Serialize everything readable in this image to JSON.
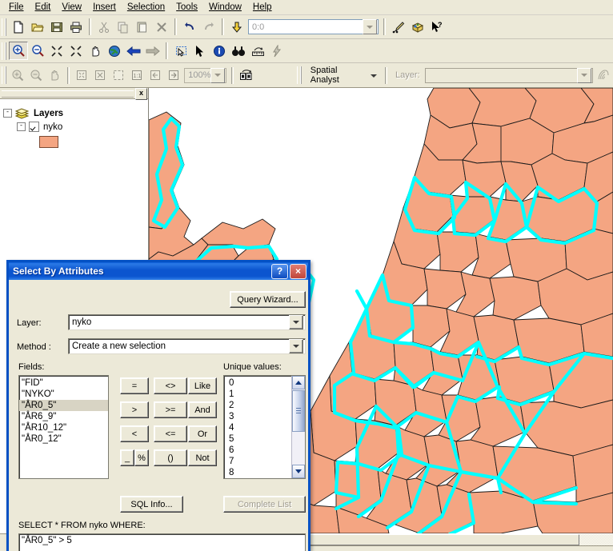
{
  "menu": {
    "items": [
      "File",
      "Edit",
      "View",
      "Insert",
      "Selection",
      "Tools",
      "Window",
      "Help"
    ]
  },
  "toolbars": {
    "standard": {
      "buttons": [
        "new-icon",
        "open-icon",
        "save-icon",
        "print-icon",
        "cut-icon",
        "copy-icon",
        "paste-icon",
        "delete-icon",
        "undo-icon",
        "redo-icon",
        "add-data-icon"
      ],
      "scale_value": "0:0",
      "editor_buttons": [
        "editor-tool-icon",
        "arctoolbox-icon",
        "whats-this-icon"
      ]
    },
    "tools": {
      "buttons": [
        "zoom-in-icon",
        "zoom-out-icon",
        "fixed-zoom-in-icon",
        "fixed-zoom-out-icon",
        "pan-icon",
        "full-extent-icon",
        "back-extent-icon",
        "forward-extent-icon",
        "select-features-icon",
        "select-elements-icon",
        "identify-icon",
        "find-icon",
        "measure-icon",
        "hyperlink-icon"
      ]
    },
    "layout": {
      "buttons": [
        "layout-zoom-in-icon",
        "layout-zoom-out-icon",
        "layout-pan-icon",
        "zoom-whole-page-icon",
        "fixed-zoom-page-icon",
        "zoom-to-page-icon",
        "one-to-one-icon",
        "go-back-page-icon",
        "go-forward-page-icon"
      ],
      "zoom_value": "100%",
      "toggle_draft_icon": "toggle-draft-mode-icon"
    },
    "spatial_analyst": {
      "menu_label": "Spatial Analyst",
      "layer_label": "Layer:",
      "layer_value": "",
      "extra_icon": "histogram-icon"
    }
  },
  "toc": {
    "close_label": "x",
    "root": {
      "label": "Layers",
      "expander": "-",
      "icon": "layers-stack-icon"
    },
    "layer": {
      "label": "nyko",
      "expander": "-",
      "checked": true,
      "swatch_color": "#f4a582"
    }
  },
  "map": {
    "polygon_fill": "#f4a582",
    "polygon_outline": "#000000",
    "selection_color": "#00ffff",
    "background": "#ffffff"
  },
  "dialog": {
    "title": "Select By Attributes",
    "help_button": "?",
    "close_button": "×",
    "query_wizard_label": "Query Wizard...",
    "layer_label": "Layer:",
    "layer_value": "nyko",
    "method_label": "Method :",
    "method_value": "Create a new selection",
    "fields_label": "Fields:",
    "fields": [
      "\"FID\"",
      "\"NYKO\"",
      "\"ÅR0_5\"",
      "\"ÅR6_9\"",
      "\"ÅR10_12\"",
      "\"ÅR0_12\""
    ],
    "selected_field_index": 2,
    "unique_values_label": "Unique values:",
    "unique_values": [
      "0",
      "1",
      "2",
      "3",
      "4",
      "5",
      "6",
      "7",
      "8"
    ],
    "operators": [
      [
        "=",
        "<>",
        "Like"
      ],
      [
        ">",
        ">=",
        "And"
      ],
      [
        "<",
        "<=",
        "Or"
      ],
      [
        "_",
        "%",
        "()",
        "Not"
      ]
    ],
    "sql_info_label": "SQL Info...",
    "complete_list_label": "Complete List",
    "complete_list_enabled": false,
    "sql_prefix": "SELECT * FROM nyko WHERE:",
    "sql_expression": "\"ÅR0_5\" > 5"
  }
}
